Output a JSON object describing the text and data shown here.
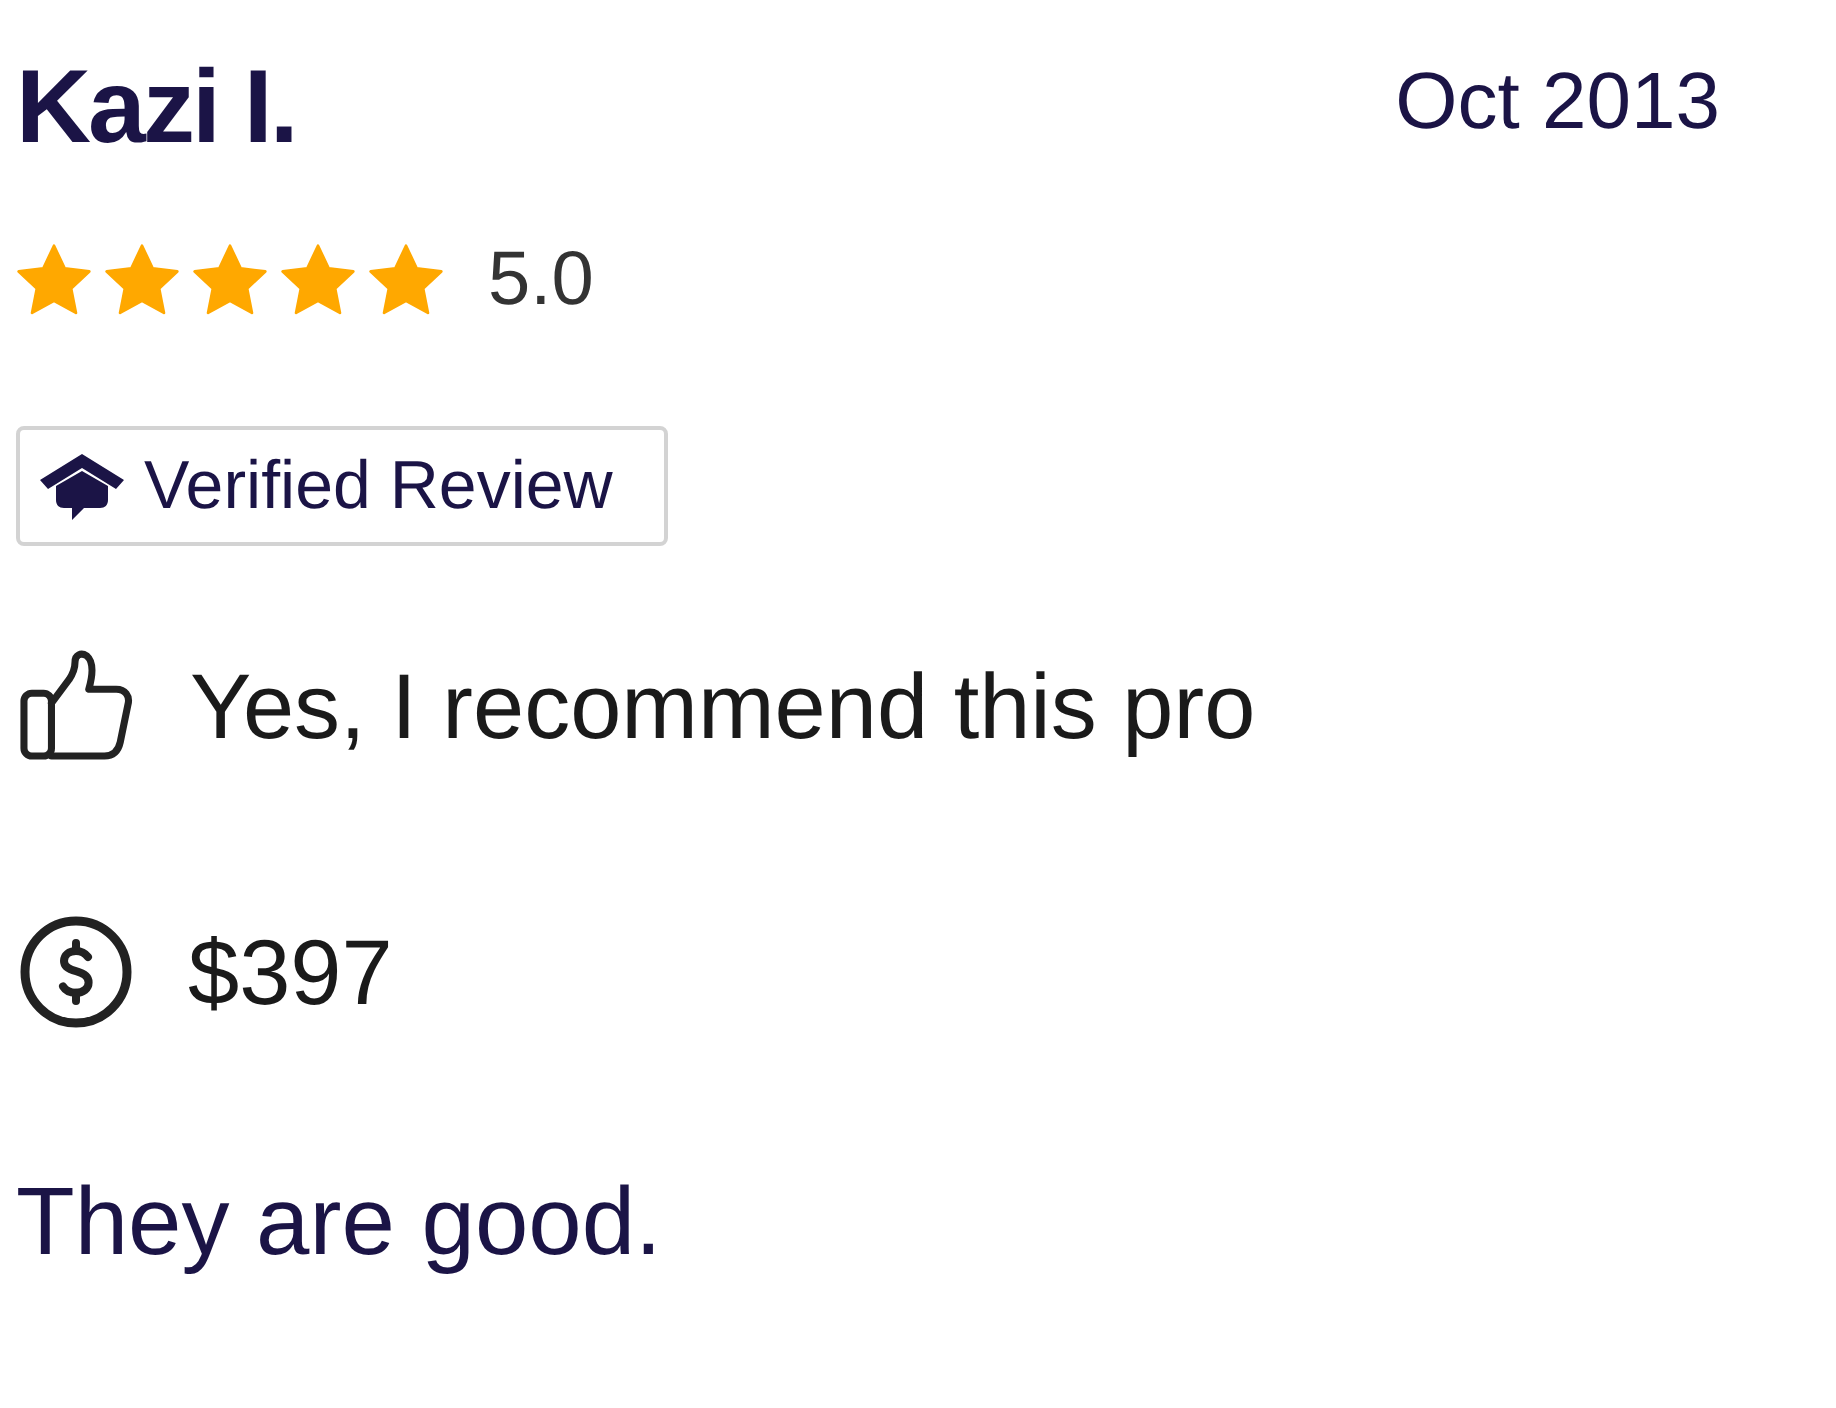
{
  "reviewer": {
    "name": "Kazi I.",
    "date": "Oct 2013"
  },
  "rating": {
    "stars": 5,
    "score": "5.0"
  },
  "badge": {
    "label": "Verified Review"
  },
  "details": [
    {
      "kind": "recommend",
      "text": "Yes, I recommend this pro"
    },
    {
      "kind": "price",
      "text": "$397"
    }
  ],
  "review_text": "They are good."
}
